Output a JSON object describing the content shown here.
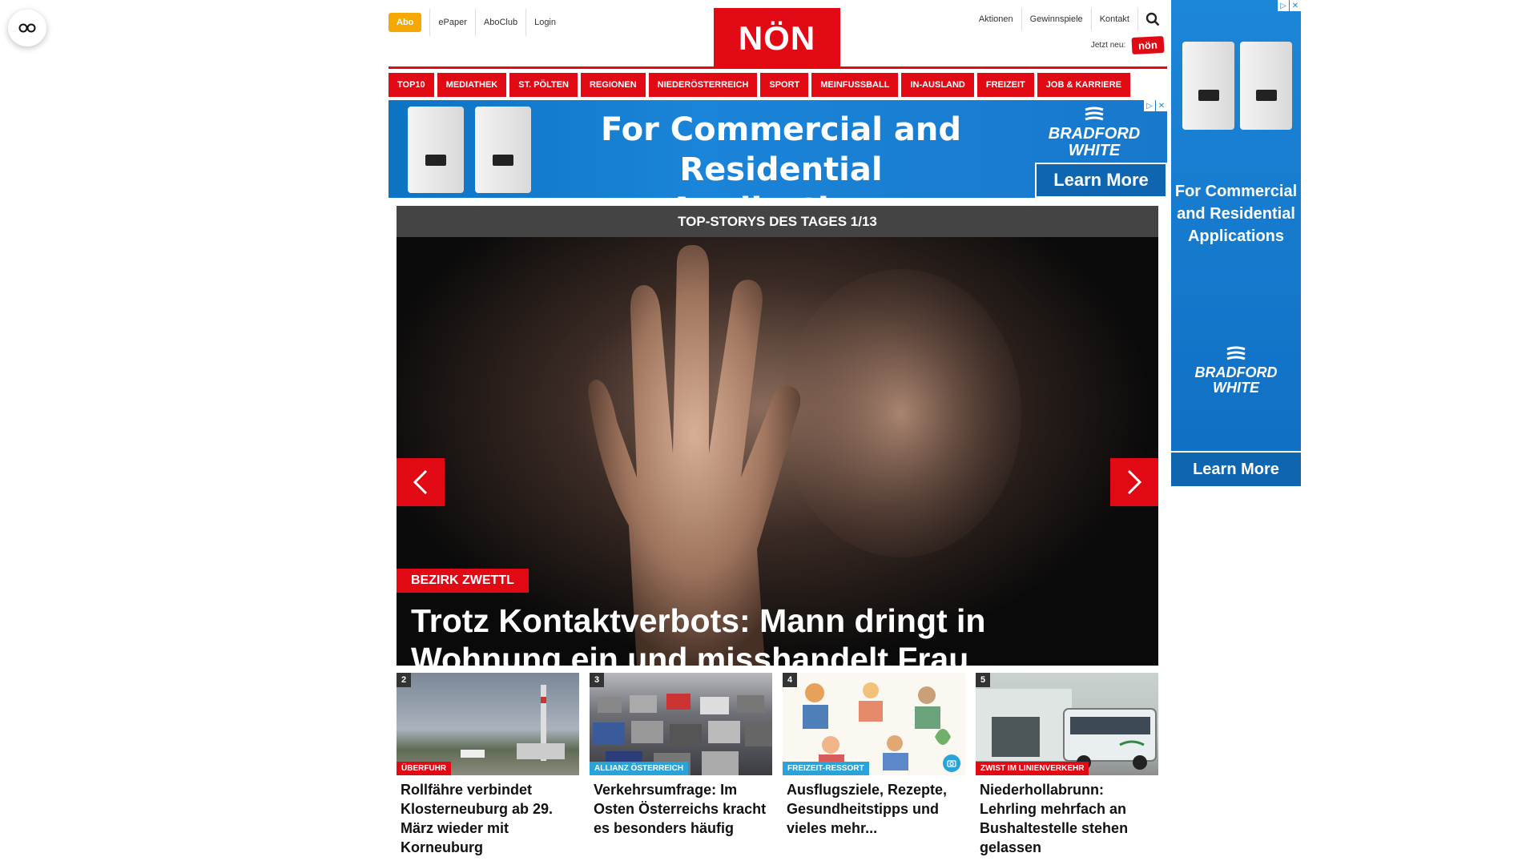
{
  "header": {
    "abo_label": "Abo",
    "top_links": [
      "ePaper",
      "AboClub",
      "Login"
    ],
    "logo_text": "NÖN",
    "right_links": [
      "Aktionen",
      "Gewinnspiele",
      "Kontakt"
    ],
    "jetzt_label": "Jetzt neu:",
    "app_logo_text": "nön"
  },
  "nav": {
    "items": [
      "TOP10",
      "MEDIATHEK",
      "ST. PÖLTEN",
      "REGIONEN",
      "NIEDERÖSTERREICH",
      "SPORT",
      "MEINFUSSBALL",
      "IN-AUSLAND",
      "FREIZEIT",
      "JOB & KARRIERE"
    ]
  },
  "banner_ad": {
    "headline": "For Commercial and Residential Applications",
    "brand": "BRADFORD WHITE",
    "cta": "Learn More"
  },
  "side_ad": {
    "headline": "For Commercial and Residential Applications",
    "brand": "BRADFORD WHITE",
    "cta": "Learn More"
  },
  "hero": {
    "bar_title": "TOP-STORYS DES TAGES 1/13",
    "tag": "BEZIRK ZWETTL",
    "title": "Trotz Kontaktverbots: Mann dringt in Wohnung ein und misshandelt Frau"
  },
  "teasers": [
    {
      "num": "2",
      "tag": "ÜBERFUHR",
      "tag_color": "#e10a14",
      "title": "Rollfähre verbindet Klosterneuburg ab 29. März wieder mit Korneuburg"
    },
    {
      "num": "3",
      "tag": "ALLIANZ ÖSTERREICH",
      "tag_color": "#29a3d8",
      "title": "Verkehrsumfrage: Im Osten Österreichs kracht es besonders häufig"
    },
    {
      "num": "4",
      "tag": "FREIZEIT-RESSORT",
      "tag_color": "#29a3d8",
      "title": "Ausflugsziele, Rezepte, Gesundheitstipps und vieles mehr..."
    },
    {
      "num": "5",
      "tag": "ZWIST IM LINIENVERKEHR",
      "tag_color": "#e10a14",
      "title": "Niederhollabrunn: Lehrling mehrfach an Bushaltestelle stehen gelassen"
    }
  ]
}
